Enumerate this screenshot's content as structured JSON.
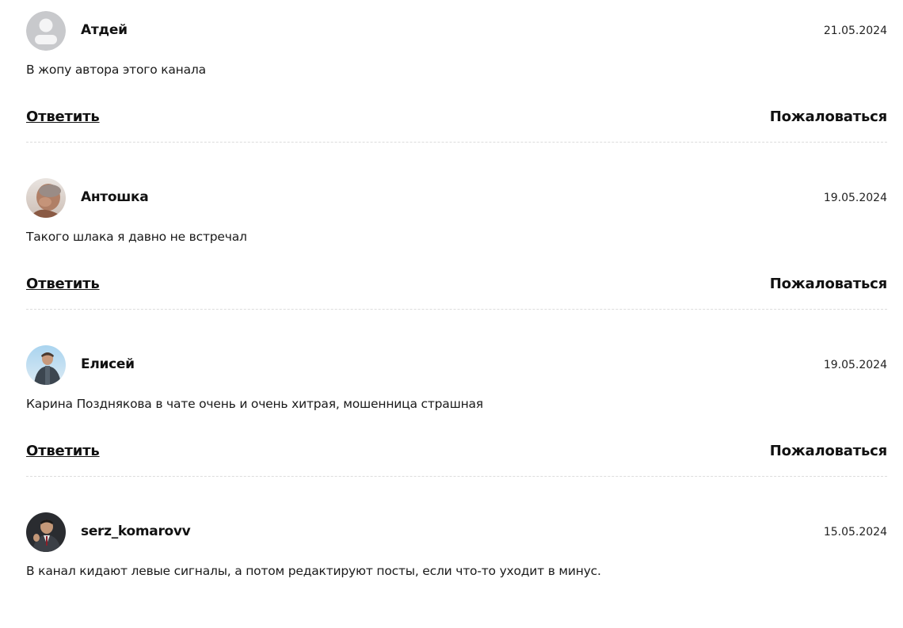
{
  "comments": [
    {
      "author": "Атдей",
      "date": "21.05.2024",
      "text": "В жопу автора этого канала",
      "avatar": "default-user-icon",
      "reply_label": "Ответить",
      "report_label": "Пожаловаться"
    },
    {
      "author": "Антошка",
      "date": "19.05.2024",
      "text": "Такого шлака я давно не встречал",
      "avatar": "user-photo",
      "reply_label": "Ответить",
      "report_label": "Пожаловаться"
    },
    {
      "author": "Елисей",
      "date": "19.05.2024",
      "text": "Карина Позднякова в чате очень и очень хитрая, мошенница страшная",
      "avatar": "user-photo",
      "reply_label": "Ответить",
      "report_label": "Пожаловаться"
    },
    {
      "author": "serz_komarovv",
      "date": "15.05.2024",
      "text": "В канал кидают левые сигналы, а потом редактируют посты, если что-то уходит в минус.",
      "avatar": "user-photo"
    }
  ],
  "colors": {
    "text": "#111111",
    "divider": "#dcdcdc",
    "default_avatar_bg": "#c8c9cc",
    "default_avatar_fg": "#f4f4f5"
  }
}
